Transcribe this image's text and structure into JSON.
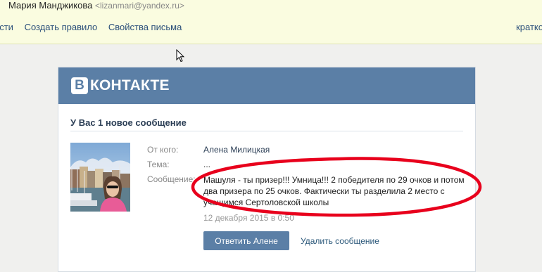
{
  "mail": {
    "sender_name": "Мария Манджикова",
    "sender_email": "<lizanmari@yandex.ru>",
    "actions": [
      "ести",
      "Создать правило",
      "Свойства письма"
    ],
    "view_toggle": "кратко"
  },
  "vk": {
    "logo_letter": "В",
    "logo_text": "КОНТАКТЕ",
    "notice": "У Вас 1 новое сообщение",
    "labels": {
      "from": "От кого:",
      "subject": "Тема:",
      "message": "Сообщение:"
    },
    "from_value": "Алена Милицкая",
    "subject_value": "...",
    "message_value": "Машуля - ты призер!!! Умница!!! 2 победителя по 29 очков и потом два призера по 25 очков. Фактически ты разделила 2 место с учащимся Сертоловской школы",
    "date_value": "12 декабря 2015 в 0:50",
    "reply_button": "Ответить Алене",
    "delete_link": "Удалить сообщение"
  },
  "colors": {
    "vk_blue": "#5b7fa6",
    "highlight_red": "#e8001c",
    "mail_bar": "#fafce0"
  }
}
